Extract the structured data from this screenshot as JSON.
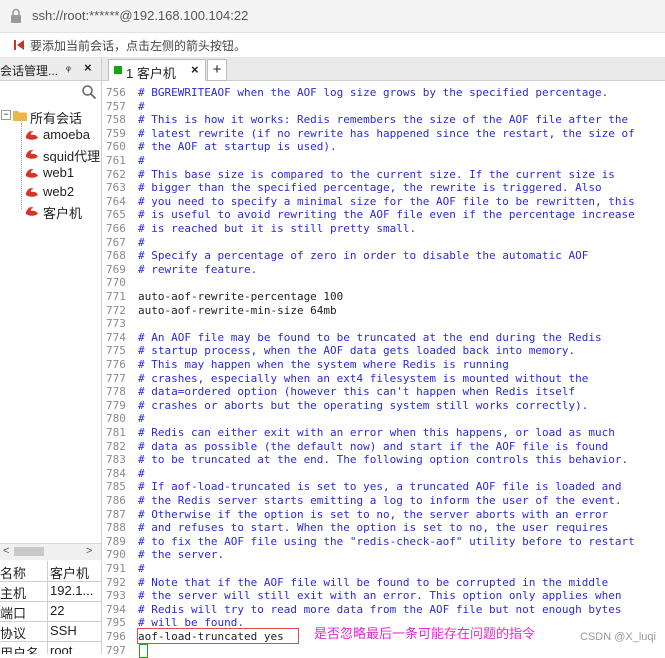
{
  "address_bar": {
    "text": "ssh://root:******@192.168.100.104:22"
  },
  "hint_bar": {
    "text": "要添加当前会话，点击左侧的箭头按钮。"
  },
  "session_manager": {
    "title": "会话管理...",
    "pin": "ᵩ",
    "close": "×",
    "tree": [
      {
        "label": "所有会话",
        "type": "folder"
      },
      {
        "label": "amoeba",
        "type": "session"
      },
      {
        "label": "squid代理",
        "type": "session"
      },
      {
        "label": "web1",
        "type": "session"
      },
      {
        "label": "web2",
        "type": "session"
      },
      {
        "label": "客户机",
        "type": "session"
      }
    ],
    "scroll_left": "<",
    "scroll_right": ">",
    "properties": [
      {
        "key": "名称",
        "value": "客户机"
      },
      {
        "key": "主机",
        "value": "192.1..."
      },
      {
        "key": "端口",
        "value": "22"
      },
      {
        "key": "协议",
        "value": "SSH"
      },
      {
        "key": "用户名",
        "value": "root"
      }
    ]
  },
  "tabs": {
    "active_label": "1 客户机",
    "close": "×",
    "add": "+"
  },
  "terminal": {
    "lines": [
      {
        "n": "756",
        "t": "# BGREWRITEAOF when the AOF log size grows by the specified percentage.",
        "c": true
      },
      {
        "n": "757",
        "t": "#",
        "c": true
      },
      {
        "n": "758",
        "t": "# This is how it works: Redis remembers the size of the AOF file after the",
        "c": true
      },
      {
        "n": "759",
        "t": "# latest rewrite (if no rewrite has happened since the restart, the size of",
        "c": true
      },
      {
        "n": "760",
        "t": "# the AOF at startup is used).",
        "c": true
      },
      {
        "n": "761",
        "t": "#",
        "c": true
      },
      {
        "n": "762",
        "t": "# This base size is compared to the current size. If the current size is",
        "c": true
      },
      {
        "n": "763",
        "t": "# bigger than the specified percentage, the rewrite is triggered. Also",
        "c": true
      },
      {
        "n": "764",
        "t": "# you need to specify a minimal size for the AOF file to be rewritten, this",
        "c": true
      },
      {
        "n": "765",
        "t": "# is useful to avoid rewriting the AOF file even if the percentage increase",
        "c": true
      },
      {
        "n": "766",
        "t": "# is reached but it is still pretty small.",
        "c": true
      },
      {
        "n": "767",
        "t": "#",
        "c": true
      },
      {
        "n": "768",
        "t": "# Specify a percentage of zero in order to disable the automatic AOF",
        "c": true
      },
      {
        "n": "769",
        "t": "# rewrite feature.",
        "c": true
      },
      {
        "n": "770",
        "t": "",
        "c": false
      },
      {
        "n": "771",
        "t": "auto-aof-rewrite-percentage 100",
        "c": false
      },
      {
        "n": "772",
        "t": "auto-aof-rewrite-min-size 64mb",
        "c": false
      },
      {
        "n": "773",
        "t": "",
        "c": false
      },
      {
        "n": "774",
        "t": "# An AOF file may be found to be truncated at the end during the Redis",
        "c": true
      },
      {
        "n": "775",
        "t": "# startup process, when the AOF data gets loaded back into memory.",
        "c": true
      },
      {
        "n": "776",
        "t": "# This may happen when the system where Redis is running",
        "c": true
      },
      {
        "n": "777",
        "t": "# crashes, especially when an ext4 filesystem is mounted without the",
        "c": true
      },
      {
        "n": "778",
        "t": "# data=ordered option (however this can't happen when Redis itself",
        "c": true
      },
      {
        "n": "779",
        "t": "# crashes or aborts but the operating system still works correctly).",
        "c": true
      },
      {
        "n": "780",
        "t": "#",
        "c": true
      },
      {
        "n": "781",
        "t": "# Redis can either exit with an error when this happens, or load as much",
        "c": true
      },
      {
        "n": "782",
        "t": "# data as possible (the default now) and start if the AOF file is found",
        "c": true
      },
      {
        "n": "783",
        "t": "# to be truncated at the end. The following option controls this behavior.",
        "c": true
      },
      {
        "n": "784",
        "t": "#",
        "c": true
      },
      {
        "n": "785",
        "t": "# If aof-load-truncated is set to yes, a truncated AOF file is loaded and",
        "c": true
      },
      {
        "n": "786",
        "t": "# the Redis server starts emitting a log to inform the user of the event.",
        "c": true
      },
      {
        "n": "787",
        "t": "# Otherwise if the option is set to no, the server aborts with an error",
        "c": true
      },
      {
        "n": "788",
        "t": "# and refuses to start. When the option is set to no, the user requires",
        "c": true
      },
      {
        "n": "789",
        "t": "# to fix the AOF file using the \"redis-check-aof\" utility before to restart",
        "c": true
      },
      {
        "n": "790",
        "t": "# the server.",
        "c": true
      },
      {
        "n": "791",
        "t": "#",
        "c": true
      },
      {
        "n": "792",
        "t": "# Note that if the AOF file will be found to be corrupted in the middle",
        "c": true
      },
      {
        "n": "793",
        "t": "# the server will still exit with an error. This option only applies when",
        "c": true
      },
      {
        "n": "794",
        "t": "# Redis will try to read more data from the AOF file but not enough bytes",
        "c": true
      },
      {
        "n": "795",
        "t": "# will be found.",
        "c": true
      },
      {
        "n": "796",
        "t": "aof-load-truncated yes",
        "c": false
      },
      {
        "n": "797",
        "t": "",
        "c": false
      }
    ]
  },
  "annotation": "是否忽略最后一条可能存在问题的指令",
  "watermark": "CSDN @X_luqi",
  "colors": {
    "comment": "#2b2bd6",
    "annotation": "#e02ad0",
    "highlight_box": "#e24b4b",
    "tab_dot": "#14a614"
  }
}
